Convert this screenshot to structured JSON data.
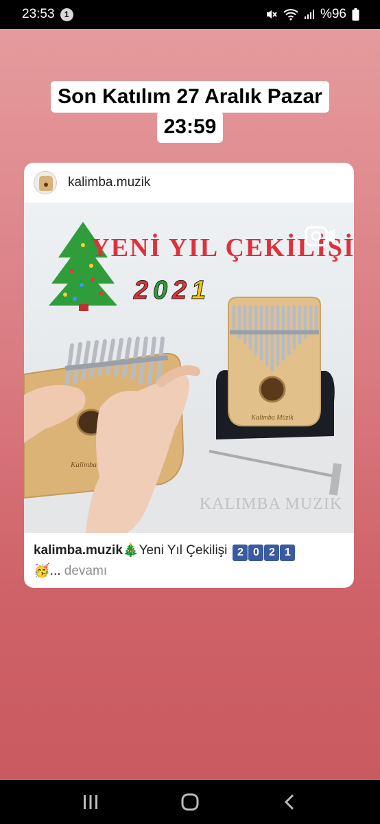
{
  "status_bar": {
    "time": "23:53",
    "notification_count": "1",
    "battery": "%96"
  },
  "story": {
    "headline_line1": "Son Katılım 27 Aralık Pazar",
    "headline_line2": "23:59"
  },
  "post": {
    "username": "kalimba.muzik",
    "image": {
      "title_text": "YENİ YIL ÇEKİLİŞİ",
      "year_text": "2021",
      "watermark": "KALIMBA MUZIK",
      "tine_label": "Kalimba Müzik"
    },
    "caption": {
      "user": "kalimba.muzik",
      "tree_emoji": "🎄",
      "text": "Yeni Yıl Çekilişi",
      "digits": [
        "2",
        "0",
        "2",
        "1"
      ],
      "party_emoji": "🥳",
      "ellipsis": "...",
      "more": "devamı"
    }
  },
  "icons": {
    "video": "video-camera-icon",
    "mute": "mute-icon",
    "wifi": "wifi-icon",
    "signal": "signal-icon",
    "battery": "battery-icon",
    "recents": "recents-icon",
    "home": "home-icon",
    "back": "back-icon"
  },
  "colors": {
    "story_top": "#e59b9d",
    "story_bottom": "#c85a60",
    "title_red": "#e0303c",
    "digit_box": "#3a5ba0"
  }
}
